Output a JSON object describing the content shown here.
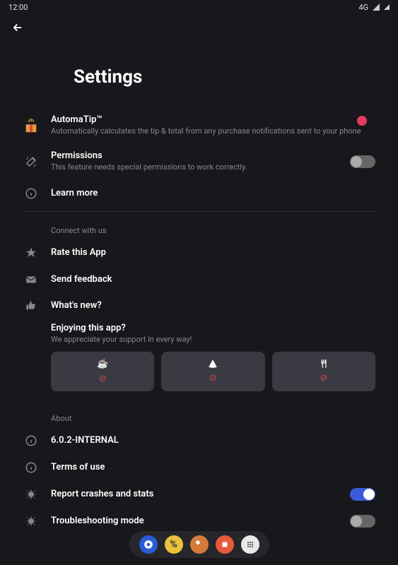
{
  "status": {
    "time": "12:00",
    "network": "4G"
  },
  "page_title": "Settings",
  "automatip": {
    "title": "AutomaTip™",
    "subtitle": "Automatically calculates the tip & total from any purchase notifications sent to your phone"
  },
  "permissions": {
    "title": "Permissions",
    "subtitle": "This feature needs special permissions to work correctly.",
    "enabled": false
  },
  "learn_more": "Learn more",
  "connect_section": "Connect with us",
  "rate": "Rate this App",
  "feedback": "Send feedback",
  "whatsnew": "What's new?",
  "enjoying": {
    "title": "Enjoying this app?",
    "subtitle": "We appreciate your support in every way!"
  },
  "about_section": "About",
  "version": "6.0.2-INTERNAL",
  "terms": "Terms of use",
  "crashes": {
    "label": "Report crashes and stats",
    "enabled": true
  },
  "troubleshoot": {
    "label": "Troubleshooting mode",
    "enabled": false
  }
}
